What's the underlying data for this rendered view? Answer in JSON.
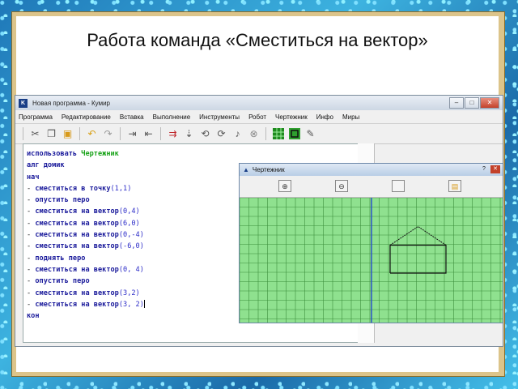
{
  "slide": {
    "title": "Работа команда «Сместиться на вектор»"
  },
  "window": {
    "title": "Новая программа - Кумир",
    "app_icon_letter": "K",
    "menu": [
      "Программа",
      "Редактирование",
      "Вставка",
      "Выполнение",
      "Инструменты",
      "Робот",
      "Чертежник",
      "Инфо",
      "Миры"
    ]
  },
  "toolbar_icons": [
    "cut-icon",
    "copy-icon",
    "paste-icon",
    "undo-icon",
    "redo-icon",
    "indent-icon",
    "outdent-icon",
    "run-icon",
    "step-icon",
    "step-into-icon",
    "step-out-icon",
    "trace-icon",
    "stop-icon",
    "robot-world-icon",
    "drawer-world-icon",
    "edit-icon"
  ],
  "code": {
    "line1": {
      "kw": "использовать",
      "exe": "Чертежник"
    },
    "line2": {
      "kw": "алг",
      "name": "домик"
    },
    "line3": {
      "kw": "нач"
    },
    "cmd_move_to": "сместиться в точку",
    "cmd_pen_down": "опустить перо",
    "cmd_move_vec": "сместиться на вектор",
    "cmd_pen_up": "поднять перо",
    "line15": {
      "kw": "кон"
    },
    "args": [
      "(1,1)",
      "(0,4)",
      "(6,0)",
      "(0,-4)",
      "(-6,0)",
      "(0, 4)",
      "(3,2)",
      "(3, 2)"
    ]
  },
  "drawer": {
    "title": "Чертежник"
  },
  "colors": {
    "grid_bg": "#8fe18f",
    "grid_line": "#3d8f3d",
    "axis": "#2a56c8",
    "figure": "#111111"
  }
}
